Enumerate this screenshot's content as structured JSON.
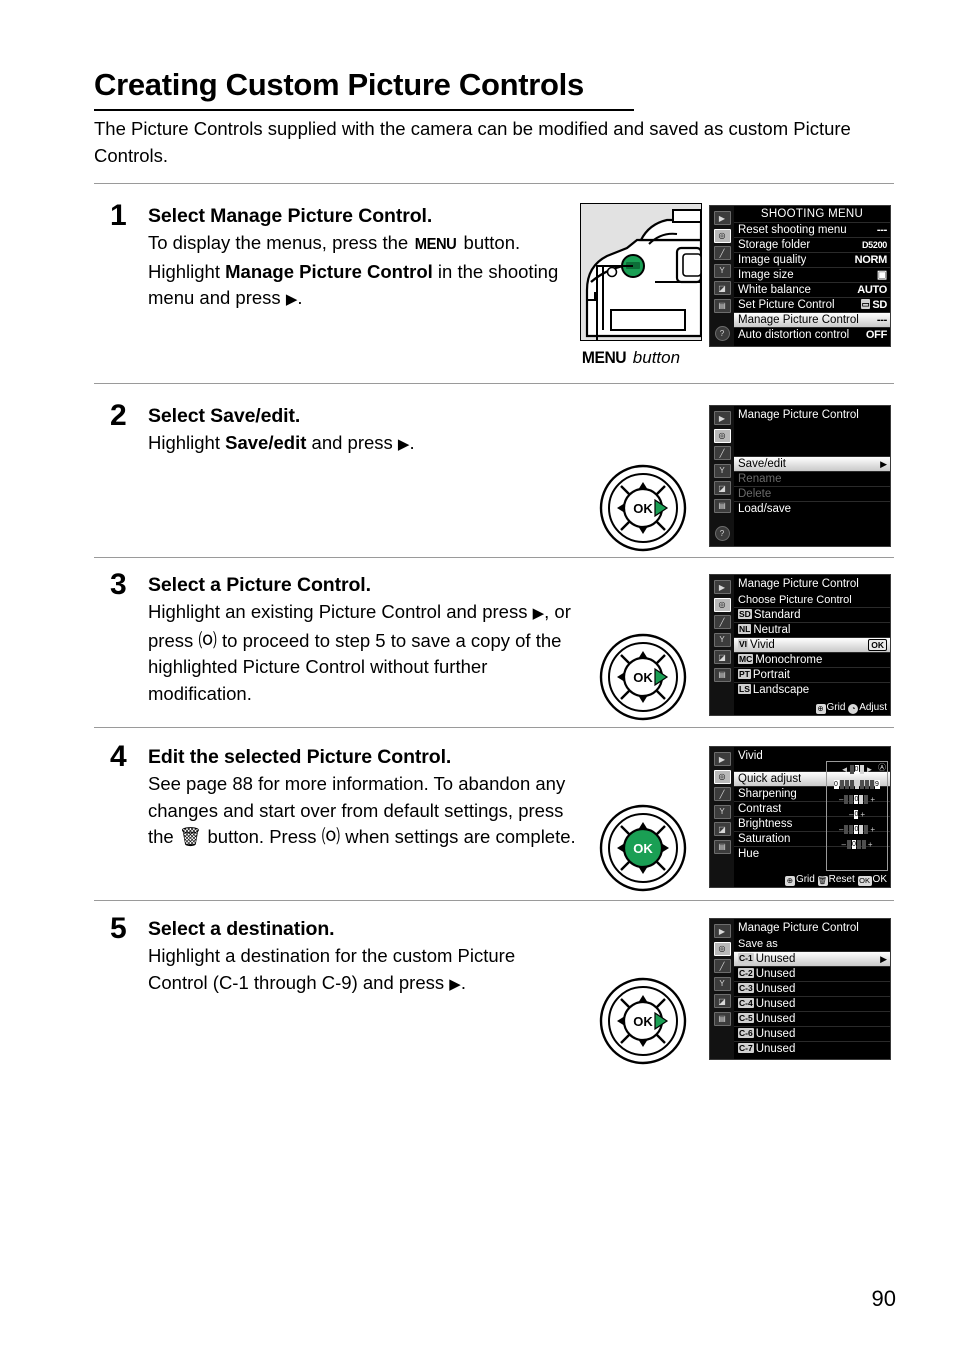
{
  "document": {
    "title": "Creating Custom Picture Controls",
    "intro": "The Picture Controls supplied with the camera can be modified and saved as custom Picture Controls.",
    "page_number": "90"
  },
  "camera_figure": {
    "caption_button": "MENU",
    "caption_word": "button",
    "highlight_color": "#1a9f54"
  },
  "steps": [
    {
      "number": "1",
      "title": "Select Manage Picture Control.",
      "text_1": "To display the menus, press the ",
      "menu_word": "MENU",
      "text_2": " button. Highlight ",
      "bold_1": "Manage Picture Control",
      "text_3": " in the shooting menu and press ",
      "arrow": "▶",
      "text_4": "."
    },
    {
      "number": "2",
      "title": "Select Save/edit.",
      "text_1": "Highlight ",
      "bold_1": "Save/edit",
      "text_2": " and press ",
      "arrow": "▶",
      "text_3": "."
    },
    {
      "number": "3",
      "title": "Select a Picture Control.",
      "text_1": "Highlight an existing Picture Control and press ",
      "arrow": "▶",
      "text_2": ", or press ",
      "ok": "⒪",
      "text_3": " to proceed to step 5 to save a copy of the highlighted Picture Control without further modification."
    },
    {
      "number": "4",
      "title": "Edit the selected Picture Control.",
      "text_1": "See page 88 for more information.  To abandon any changes and start over from default settings, press the ",
      "trash": "Ὕ1",
      "text_2": " button.  Press ",
      "ok": "⒪",
      "text_3": " when settings are complete."
    },
    {
      "number": "5",
      "title": "Select a destination.",
      "text_1": "Highlight a destination for the custom Picture Control (C-1 through C-9) and press ",
      "arrow": "▶",
      "text_2": "."
    }
  ],
  "lcd_sidebar": {
    "icons": [
      "playback-icon",
      "shooting-menu-icon",
      "custom-setting-icon",
      "setup-icon",
      "retouch-icon",
      "recent-settings-icon",
      "help-icon"
    ],
    "glyphs": [
      "▶",
      "◎",
      "╱",
      "Υ",
      "◩",
      "⌸",
      "?"
    ],
    "selected_index": 1
  },
  "lcd_shooting_menu": {
    "header": "SHOOTING MENU",
    "rows": [
      {
        "label": "Reset shooting menu",
        "value": "---",
        "highlighted": false
      },
      {
        "label": "Storage folder",
        "value": "D5200",
        "highlighted": false
      },
      {
        "label": "Image quality",
        "value": "NORM",
        "highlighted": false
      },
      {
        "label": "Image size",
        "value": "▣",
        "highlighted": false
      },
      {
        "label": "White balance",
        "value": "AUTO",
        "highlighted": false
      },
      {
        "label": "Set Picture Control",
        "value": "SD",
        "highlighted": false
      },
      {
        "label": "Manage Picture Control",
        "value": "---",
        "highlighted": true
      },
      {
        "label": "Auto distortion control",
        "value": "OFF",
        "highlighted": false
      }
    ]
  },
  "lcd_manage_menu": {
    "title": "Manage Picture Control",
    "rows": [
      {
        "label": "Save/edit",
        "value": "▶",
        "highlighted": true,
        "dimmed": false
      },
      {
        "label": "Rename",
        "value": "",
        "highlighted": false,
        "dimmed": true
      },
      {
        "label": "Delete",
        "value": "",
        "highlighted": false,
        "dimmed": true
      },
      {
        "label": "Load/save",
        "value": "",
        "highlighted": false,
        "dimmed": false
      }
    ]
  },
  "lcd_choose_picture_control": {
    "title": "Manage Picture Control",
    "subtitle": "Choose Picture Control",
    "rows": [
      {
        "tag": "SD",
        "label": "Standard",
        "badge": "",
        "highlighted": false
      },
      {
        "tag": "NL",
        "label": "Neutral",
        "badge": "",
        "highlighted": false
      },
      {
        "tag": "VI",
        "label": "Vivid",
        "badge": "OK",
        "highlighted": true
      },
      {
        "tag": "MC",
        "label": "Monochrome",
        "badge": "",
        "highlighted": false
      },
      {
        "tag": "PT",
        "label": "Portrait",
        "badge": "",
        "highlighted": false
      },
      {
        "tag": "LS",
        "label": "Landscape",
        "badge": "",
        "highlighted": false
      }
    ],
    "footer": [
      {
        "icon": "⊕",
        "label": "Grid"
      },
      {
        "icon": "◔",
        "label": "Adjust"
      }
    ]
  },
  "lcd_edit_picture_control": {
    "title": "Vivid",
    "auto_mark": "Ⓐ",
    "rows": [
      {
        "label": "Quick adjust",
        "highlighted": true,
        "type": "quick"
      },
      {
        "label": "Sharpening",
        "highlighted": false,
        "type": "long"
      },
      {
        "label": "Contrast",
        "highlighted": false,
        "type": "pm"
      },
      {
        "label": "Brightness",
        "highlighted": false,
        "type": "short"
      },
      {
        "label": "Saturation",
        "highlighted": false,
        "type": "pm"
      },
      {
        "label": "Hue",
        "highlighted": false,
        "type": "pm2"
      }
    ],
    "footer": [
      {
        "icon": "⊕",
        "label": "Grid"
      },
      {
        "icon": "Ὕ1",
        "label": "Reset"
      },
      {
        "icon": "OK",
        "label": "OK"
      }
    ]
  },
  "lcd_save_as": {
    "title": "Manage Picture Control",
    "subtitle": "Save as",
    "rows": [
      {
        "tag": "C-1",
        "label": "Unused",
        "highlighted": true
      },
      {
        "tag": "C-2",
        "label": "Unused",
        "highlighted": false
      },
      {
        "tag": "C-3",
        "label": "Unused",
        "highlighted": false
      },
      {
        "tag": "C-4",
        "label": "Unused",
        "highlighted": false
      },
      {
        "tag": "C-5",
        "label": "Unused",
        "highlighted": false
      },
      {
        "tag": "C-6",
        "label": "Unused",
        "highlighted": false
      },
      {
        "tag": "C-7",
        "label": "Unused",
        "highlighted": false
      }
    ]
  },
  "dpad": {
    "ok_label": "OK",
    "up": "▲",
    "down": "▼",
    "left": "◀",
    "right": "▶",
    "highlight_color": "#1a9f54"
  }
}
